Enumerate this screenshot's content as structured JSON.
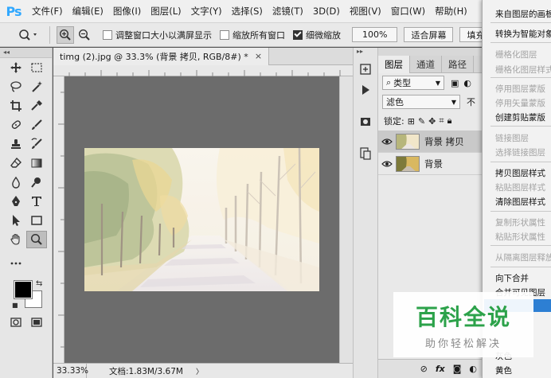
{
  "app": {
    "logo": "Ps"
  },
  "menubar": {
    "items": [
      "文件(F)",
      "编辑(E)",
      "图像(I)",
      "图层(L)",
      "文字(Y)",
      "选择(S)",
      "滤镜(T)",
      "3D(D)",
      "视图(V)",
      "窗口(W)",
      "帮助(H)"
    ]
  },
  "options": {
    "resize_windows": "调整窗口大小以满屏显示",
    "zoom_all_windows": "缩放所有窗口",
    "scrubby_zoom": "细微缩放",
    "zoom_value": "100%",
    "fit_screen": "适合屏幕",
    "fill_screen": "填充屏幕",
    "resize_checked": false,
    "zoom_all_checked": false,
    "scrubby_checked": true
  },
  "document": {
    "tab_title": "timg (2).jpg @ 33.3% (背景 拷贝, RGB/8#) *",
    "close_symbol": "×",
    "status_zoom": "33.33%",
    "status_info": "文档:1.83M/3.67M",
    "status_arrow": "〉"
  },
  "layers_panel": {
    "tabs": [
      "图层",
      "通道",
      "路径"
    ],
    "filter_kind": "类型",
    "blend_mode": "滤色",
    "opacity_label": "不",
    "lock_label": "锁定:",
    "layers": [
      {
        "name": "背景 拷贝",
        "selected": true
      },
      {
        "name": "背景",
        "selected": false
      }
    ],
    "footer_fx": "fx"
  },
  "context_menu": {
    "items": [
      {
        "label": "来自图层的画板",
        "enabled": true
      },
      {
        "label": "转换为智能对象",
        "enabled": true
      },
      {
        "label": "栅格化图层",
        "enabled": false
      },
      {
        "label": "栅格化图层样式",
        "enabled": false
      },
      {
        "label": "停用图层蒙版",
        "enabled": false
      },
      {
        "label": "停用矢量蒙版",
        "enabled": false
      },
      {
        "label": "创建剪贴蒙版",
        "enabled": true
      },
      {
        "label": "链接图层",
        "enabled": false
      },
      {
        "label": "选择链接图层",
        "enabled": false
      },
      {
        "label": "拷贝图层样式",
        "enabled": true
      },
      {
        "label": "粘贴图层样式",
        "enabled": false
      },
      {
        "label": "清除图层样式",
        "enabled": true
      },
      {
        "label": "复制形状属性",
        "enabled": false
      },
      {
        "label": "粘贴形状属性",
        "enabled": false
      },
      {
        "label": "从隔离图层释放",
        "enabled": false
      },
      {
        "label": "向下合并",
        "enabled": true
      },
      {
        "label": "合并可见图层",
        "enabled": true
      },
      {
        "label": "灰色",
        "enabled": true
      },
      {
        "label": "黄色",
        "enabled": true
      }
    ]
  },
  "watermark": {
    "title": "百科全说",
    "subtitle": "助你轻松解决"
  },
  "colors": {
    "accent": "#31a8ff",
    "menu_highlight": "#2d7fd3",
    "watermark_green": "#2ca24a",
    "canvas_bg": "#6c6c6c"
  }
}
